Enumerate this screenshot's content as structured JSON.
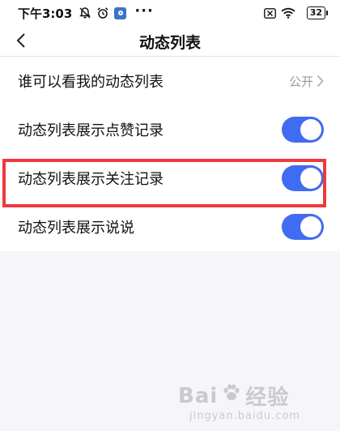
{
  "status_bar": {
    "time": "下午3:03",
    "battery": "32",
    "more": "···"
  },
  "header": {
    "title": "动态列表"
  },
  "settings": [
    {
      "label": "谁可以看我的动态列表",
      "value": "公开",
      "type": "link"
    },
    {
      "label": "动态列表展示点赞记录",
      "type": "toggle",
      "on": true
    },
    {
      "label": "动态列表展示关注记录",
      "type": "toggle",
      "on": true
    },
    {
      "label": "动态列表展示说说",
      "type": "toggle",
      "on": true
    }
  ],
  "watermark": {
    "brand_left": "Bai",
    "brand_right": "经验",
    "url": "jingyan.baidu.com"
  },
  "colors": {
    "toggle_on": "#3f6cf1",
    "highlight": "#ec3a3f",
    "app_badge": "#3b74c8"
  },
  "icons": {
    "back": "chevron-left-icon",
    "row_arrow": "chevron-right-icon",
    "status": [
      "mute-bell-icon",
      "alarm-icon",
      "app-badge-icon",
      "sim-off-icon",
      "wifi-icon",
      "battery-icon"
    ]
  }
}
